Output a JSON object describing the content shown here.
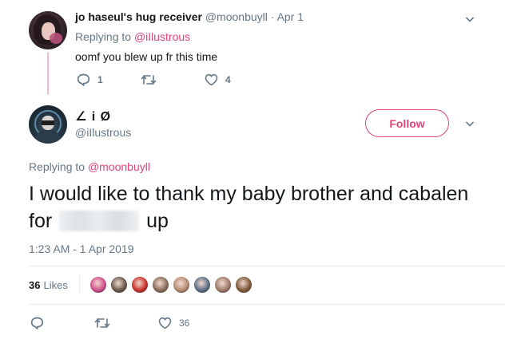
{
  "reply_tweet": {
    "name": "jo haseul's hug receiver",
    "handle": "@moonbuyll",
    "separator": "·",
    "date": "Apr 1",
    "replying_prefix": "Replying to ",
    "replying_to": "@iIlustrous",
    "text": "oomf you blew up fr this time",
    "reply_count": "1",
    "like_count": "4"
  },
  "main_tweet": {
    "name": "∠ i Ø",
    "handle": "@iIlustrous",
    "follow_label": "Follow",
    "replying_prefix": "Replying to ",
    "replying_to": "@moonbuyll",
    "text_before": "I would like to thank my baby brother and cabalen for",
    "text_after": "up",
    "timestamp": "1:23 AM - 1 Apr 2019",
    "likes_count": "36",
    "likes_label": "Likes",
    "like_count_action": "36"
  },
  "liker_avatars": [
    {
      "icon": "liker-avatar",
      "color": "#d14f8c"
    },
    {
      "icon": "liker-avatar",
      "color": "#6b5a4e"
    },
    {
      "icon": "liker-avatar",
      "color": "#c8322a"
    },
    {
      "icon": "liker-avatar",
      "color": "#8a6e5c"
    },
    {
      "icon": "liker-avatar",
      "color": "#b68a73"
    },
    {
      "icon": "liker-avatar",
      "color": "#5d6f86"
    },
    {
      "icon": "liker-avatar",
      "color": "#a07b6a"
    },
    {
      "icon": "liker-avatar",
      "color": "#7e5a3a"
    }
  ],
  "colors": {
    "accent": "#e0457b",
    "muted": "#657786",
    "thread_line": "#f4b7cf"
  }
}
